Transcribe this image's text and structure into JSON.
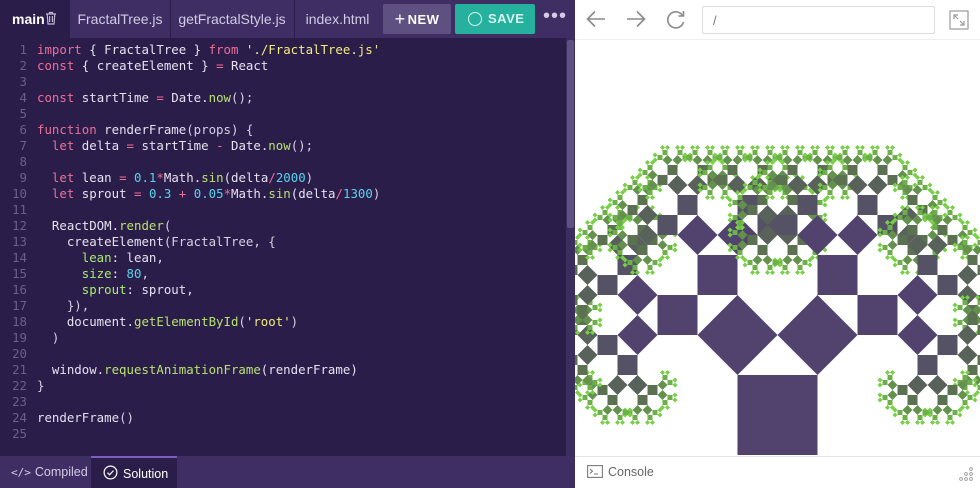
{
  "editor": {
    "tabs": {
      "main": "main",
      "fractal_tree": "FractalTree.js",
      "get_fractal_style": "getFractalStyle.js",
      "index_html": "index.html"
    },
    "new_label": "NEW",
    "save_label": "SAVE",
    "more_label": "•••",
    "code_lines": [
      [
        [
          "import",
          "kw"
        ],
        [
          " { FractalTree } ",
          "plain"
        ],
        [
          "from",
          "kw"
        ],
        [
          " ",
          "plain"
        ],
        [
          "'./FractalTree.js'",
          "str"
        ]
      ],
      [
        [
          "const",
          "kw"
        ],
        [
          " { createElement } ",
          "plain"
        ],
        [
          "=",
          "kw"
        ],
        [
          " React",
          "plain"
        ]
      ],
      [],
      [
        [
          "const",
          "kw"
        ],
        [
          " startTime ",
          "plain"
        ],
        [
          "=",
          "kw"
        ],
        [
          " Date.",
          "plain"
        ],
        [
          "now",
          "mem"
        ],
        [
          "();",
          "punc"
        ]
      ],
      [],
      [
        [
          "function",
          "kw"
        ],
        [
          " ",
          "plain"
        ],
        [
          "renderFrame",
          "fn"
        ],
        [
          "(props) {",
          "punc"
        ]
      ],
      [
        [
          "  ",
          "plain"
        ],
        [
          "let",
          "kw"
        ],
        [
          " delta ",
          "plain"
        ],
        [
          "=",
          "kw"
        ],
        [
          " startTime ",
          "plain"
        ],
        [
          "-",
          "kw"
        ],
        [
          " Date.",
          "plain"
        ],
        [
          "now",
          "mem"
        ],
        [
          "();",
          "punc"
        ]
      ],
      [],
      [
        [
          "  ",
          "plain"
        ],
        [
          "let",
          "kw"
        ],
        [
          " lean ",
          "plain"
        ],
        [
          "=",
          "kw"
        ],
        [
          " ",
          "plain"
        ],
        [
          "0.1",
          "num"
        ],
        [
          "*",
          "kw"
        ],
        [
          "Math.",
          "plain"
        ],
        [
          "sin",
          "mem"
        ],
        [
          "(delta",
          "plain"
        ],
        [
          "/",
          "kw"
        ],
        [
          "2000",
          "num"
        ],
        [
          ")",
          "punc"
        ]
      ],
      [
        [
          "  ",
          "plain"
        ],
        [
          "let",
          "kw"
        ],
        [
          " sprout ",
          "plain"
        ],
        [
          "=",
          "kw"
        ],
        [
          " ",
          "plain"
        ],
        [
          "0.3",
          "num"
        ],
        [
          " ",
          "plain"
        ],
        [
          "+",
          "kw"
        ],
        [
          " ",
          "plain"
        ],
        [
          "0.05",
          "num"
        ],
        [
          "*",
          "kw"
        ],
        [
          "Math.",
          "plain"
        ],
        [
          "sin",
          "mem"
        ],
        [
          "(delta",
          "plain"
        ],
        [
          "/",
          "kw"
        ],
        [
          "1300",
          "num"
        ],
        [
          ")",
          "punc"
        ]
      ],
      [],
      [
        [
          "  ReactDOM.",
          "plain"
        ],
        [
          "render",
          "mem"
        ],
        [
          "(",
          "punc"
        ]
      ],
      [
        [
          "    ",
          "plain"
        ],
        [
          "createElement",
          "fn"
        ],
        [
          "(FractalTree, {",
          "punc"
        ]
      ],
      [
        [
          "      ",
          "plain"
        ],
        [
          "lean",
          "prop"
        ],
        [
          ": lean,",
          "plain"
        ]
      ],
      [
        [
          "      ",
          "plain"
        ],
        [
          "size",
          "prop"
        ],
        [
          ": ",
          "plain"
        ],
        [
          "80",
          "num"
        ],
        [
          ",",
          "punc"
        ]
      ],
      [
        [
          "      ",
          "plain"
        ],
        [
          "sprout",
          "prop"
        ],
        [
          ": sprout,",
          "plain"
        ]
      ],
      [
        [
          "    }),",
          "punc"
        ]
      ],
      [
        [
          "    document.",
          "plain"
        ],
        [
          "getElementById",
          "mem"
        ],
        [
          "(",
          "punc"
        ],
        [
          "'root'",
          "str"
        ],
        [
          ")",
          "punc"
        ]
      ],
      [
        [
          "  )",
          "punc"
        ]
      ],
      [],
      [
        [
          "  window.",
          "plain"
        ],
        [
          "requestAnimationFrame",
          "mem"
        ],
        [
          "(renderFrame)",
          "plain"
        ]
      ],
      [
        [
          "}",
          "punc"
        ]
      ],
      [],
      [
        [
          "renderFrame",
          "fn"
        ],
        [
          "()",
          "punc"
        ]
      ],
      []
    ],
    "bottom_tabs": {
      "compiled": "Compiled",
      "compiled_icon": "</>",
      "solution": "Solution"
    }
  },
  "preview": {
    "url_value": "/",
    "console_label": "Console",
    "tree": {
      "size": 80,
      "max_depth": 9,
      "trunk_color": "#51436d",
      "deep_branch_color": "#5b7151",
      "leaf_color": "#76d045"
    }
  },
  "colors": {
    "editor_bg": "#2b1d4a",
    "tab_bar_bg": "#3e2e63",
    "save_green": "#26b19f",
    "new_button_bg": "#5e5080",
    "keyword": "#ee6e99",
    "string": "#f3ec7c",
    "number": "#5ad3ea",
    "property": "#a7ec6f"
  },
  "icons": {
    "main_tab": "trash-icon",
    "save": "circle-icon",
    "compiled": "code-brackets-icon",
    "solution": "check-circle-icon",
    "back": "arrow-left-icon",
    "forward": "arrow-right-icon",
    "reload": "reload-icon",
    "fullscreen": "expand-icon",
    "console": "terminal-icon",
    "resize": "resize-grip-icon"
  }
}
